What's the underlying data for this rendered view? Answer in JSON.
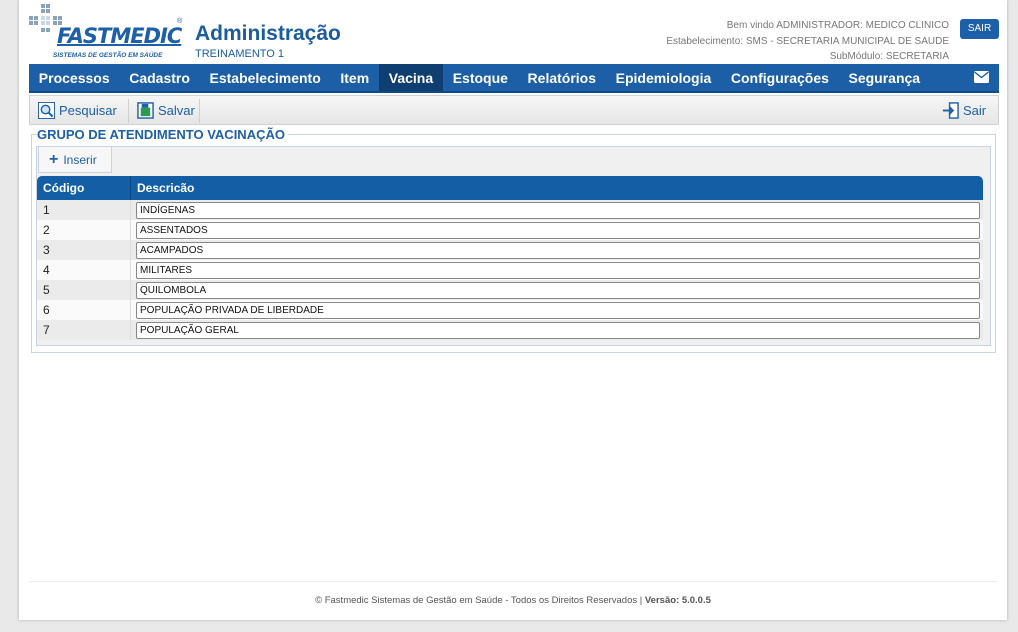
{
  "header": {
    "logo_text": "FASTMEDIC",
    "logo_subtitle": "SISTEMAS DE GESTÃO EM SAÚDE",
    "logo_reg": "®",
    "title": "Administração",
    "subtitle": "TREINAMENTO 1",
    "welcome": "Bem vindo ADMINISTRADOR: MEDICO CLINICO",
    "establishment": "Estabelecimento: SMS - SECRETARIA MUNICIPAL DE SAUDE",
    "submodule": "SubMódulo: SECRETARIA",
    "logout_label": "SAIR"
  },
  "menu": {
    "items": [
      {
        "label": "Processos",
        "active": false
      },
      {
        "label": "Cadastro",
        "active": false
      },
      {
        "label": "Estabelecimento",
        "active": false
      },
      {
        "label": "Item",
        "active": false
      },
      {
        "label": "Vacina",
        "active": true
      },
      {
        "label": "Estoque",
        "active": false
      },
      {
        "label": "Relatórios",
        "active": false
      },
      {
        "label": "Epidemiologia",
        "active": false
      },
      {
        "label": "Configurações",
        "active": false
      },
      {
        "label": "Segurança",
        "active": false
      }
    ],
    "mail_icon": "envelope-icon"
  },
  "toolbar": {
    "search_label": "Pesquisar",
    "save_label": "Salvar",
    "exit_label": "Sair"
  },
  "section": {
    "title": "GRUPO DE ATENDIMENTO VACINAÇÃO",
    "insert_label": "Inserir"
  },
  "table": {
    "columns": [
      "Código",
      "Descricão"
    ],
    "rows": [
      {
        "code": "1",
        "description": "INDÍGENAS"
      },
      {
        "code": "2",
        "description": "ASSENTADOS"
      },
      {
        "code": "3",
        "description": "ACAMPADOS"
      },
      {
        "code": "4",
        "description": "MILITARES"
      },
      {
        "code": "5",
        "description": "QUILOMBOLA"
      },
      {
        "code": "6",
        "description": "POPULAÇÃO PRIVADA DE LIBERDADE"
      },
      {
        "code": "7",
        "description": "POPULAÇÃO GERAL"
      }
    ]
  },
  "footer": {
    "text": "© Fastmedic Sistemas de Gestão em Saúde - Todos os Direitos Reservados | ",
    "version_label": "Versão: 5.0.0.5"
  },
  "colors": {
    "brand": "#1d5fa8",
    "menu_bg": "#1c5fa6",
    "menu_active": "#0f3f70",
    "grid_header": "#135ea5"
  }
}
